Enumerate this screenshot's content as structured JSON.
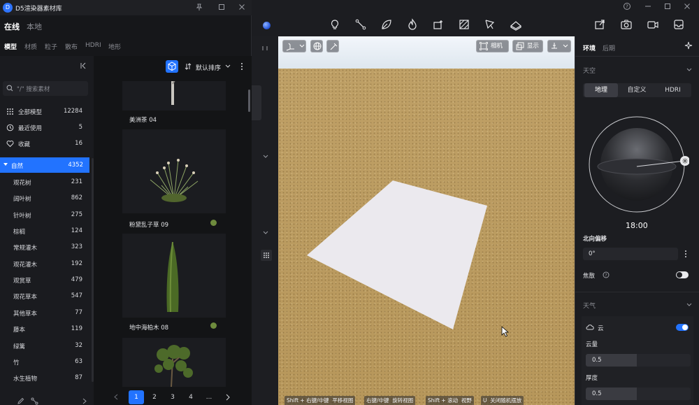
{
  "library": {
    "title": "D5渲染器素材库",
    "logo": "D",
    "tabs": [
      {
        "label": "在线"
      },
      {
        "label": "本地"
      }
    ],
    "categories": [
      {
        "label": "模型"
      },
      {
        "label": "材质"
      },
      {
        "label": "粒子"
      },
      {
        "label": "散布"
      },
      {
        "label": "HDRI"
      },
      {
        "label": "地形"
      }
    ],
    "search_placeholder": "\"/\" 搜索素材",
    "nav": [
      {
        "label": "全部模型",
        "count": "12284",
        "icon": "grid-icon"
      },
      {
        "label": "最近使用",
        "count": "5",
        "icon": "history-icon"
      },
      {
        "label": "收藏",
        "count": "16",
        "icon": "heart-icon"
      }
    ],
    "group": {
      "label": "自然",
      "count": "4352"
    },
    "subcategories": [
      {
        "label": "观花树",
        "count": "231"
      },
      {
        "label": "阔叶树",
        "count": "862"
      },
      {
        "label": "针叶树",
        "count": "275"
      },
      {
        "label": "棕榈",
        "count": "124"
      },
      {
        "label": "常规灌木",
        "count": "323"
      },
      {
        "label": "观花灌木",
        "count": "192"
      },
      {
        "label": "观赏草",
        "count": "479"
      },
      {
        "label": "观花草本",
        "count": "547"
      },
      {
        "label": "其他草本",
        "count": "77"
      },
      {
        "label": "藤本",
        "count": "119"
      },
      {
        "label": "绿篱",
        "count": "32"
      },
      {
        "label": "竹",
        "count": "63"
      },
      {
        "label": "水生植物",
        "count": "87"
      }
    ],
    "sort_label": "默认排序",
    "cards": [
      {
        "name": "美洲茶 04"
      },
      {
        "name": "粉黛乱子草 09"
      },
      {
        "name": "地中海柏木 08"
      }
    ],
    "pager": {
      "pages": [
        "1",
        "2",
        "3",
        "4",
        "..."
      ],
      "current": "1"
    }
  },
  "viewport": {
    "camera_label": "相机",
    "display_label": "显示",
    "hints": [
      {
        "key": "Shift + 右键/中键",
        "desc": "平移视图"
      },
      {
        "key": "右键/中键",
        "desc": "旋转视图"
      },
      {
        "key": "Shift + 滚动",
        "desc": "视野"
      },
      {
        "key": "U",
        "desc": "关闭随机摆放"
      }
    ]
  },
  "right_panel": {
    "tabs": [
      {
        "label": "环境"
      },
      {
        "label": "后期"
      }
    ],
    "sky_section": "天空",
    "sky_modes": [
      {
        "label": "地理"
      },
      {
        "label": "自定义"
      },
      {
        "label": "HDRI"
      }
    ],
    "time": "18:00",
    "north_offset_label": "北向偏移",
    "north_offset_value": "0°",
    "caustics_label": "焦散",
    "weather_section": "天气",
    "cloud_label": "云",
    "cloud_amount_label": "云量",
    "cloud_amount_value": "0.5",
    "thickness_label": "厚度",
    "thickness_value": "0.5",
    "accent": "#2273ff"
  }
}
